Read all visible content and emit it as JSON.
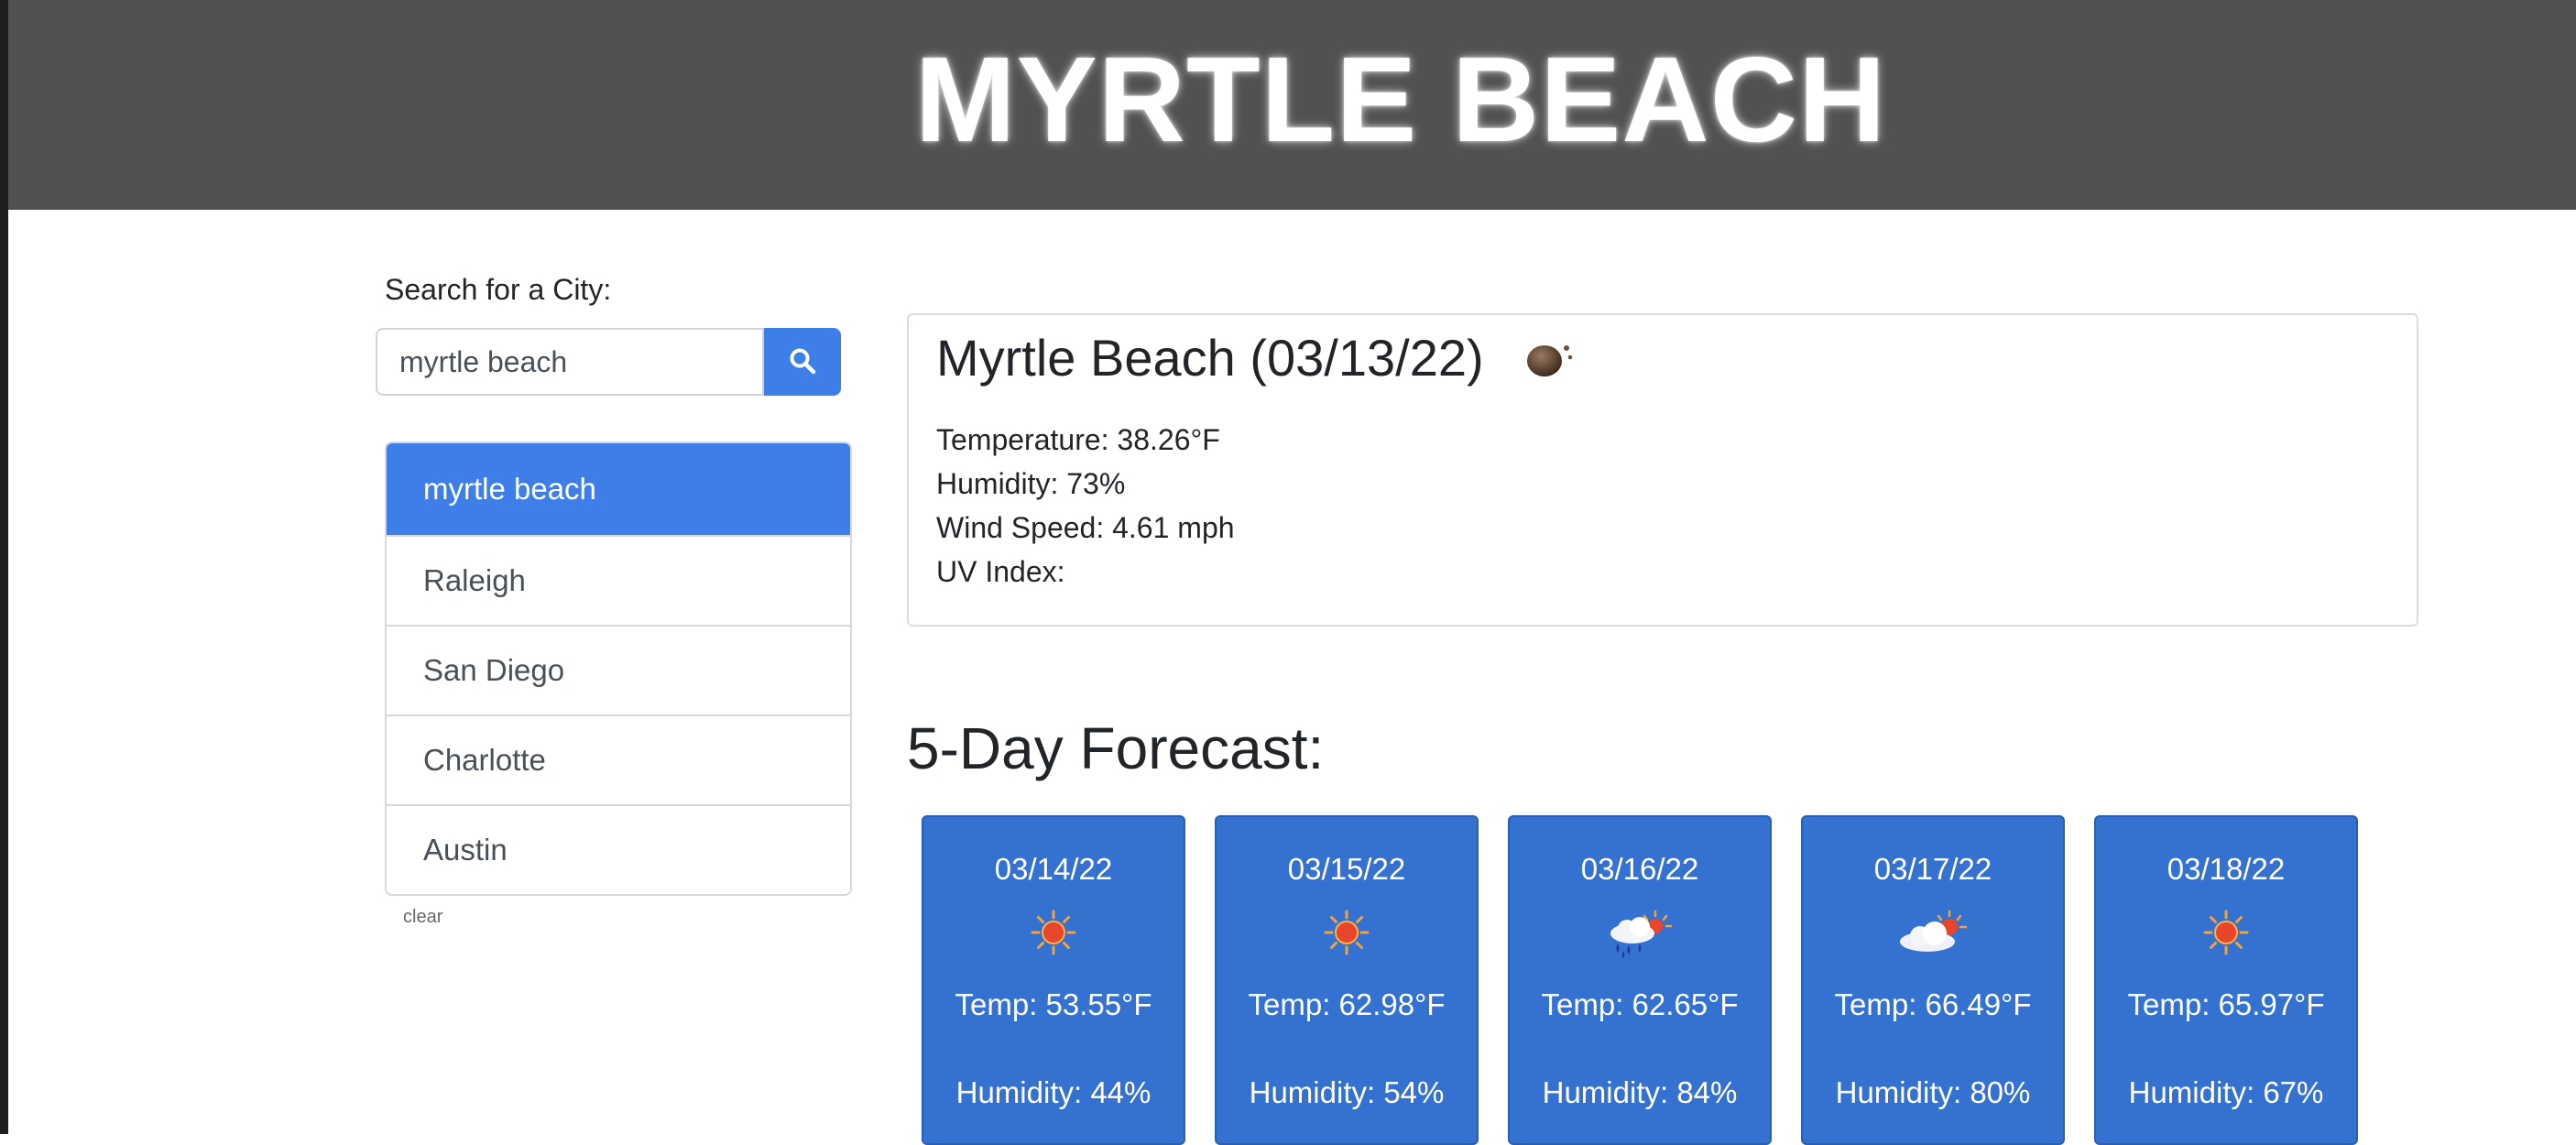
{
  "header": {
    "title": "MYRTLE BEACH"
  },
  "search": {
    "label": "Search for a City:",
    "value": "myrtle beach",
    "button_icon": "search-icon"
  },
  "history": {
    "items": [
      {
        "label": "myrtle beach",
        "active": true
      },
      {
        "label": "Raleigh",
        "active": false
      },
      {
        "label": "San Diego",
        "active": false
      },
      {
        "label": "Charlotte",
        "active": false
      },
      {
        "label": "Austin",
        "active": false
      }
    ],
    "clear_label": "clear"
  },
  "current": {
    "title": "Myrtle Beach (03/13/22)",
    "icon": "night-clear-moon-icon",
    "temperature": "Temperature: 38.26°F",
    "humidity": "Humidity: 73%",
    "wind": "Wind Speed: 4.61 mph",
    "uv": "UV Index:"
  },
  "forecast": {
    "heading": "5-Day Forecast:",
    "days": [
      {
        "date": "03/14/22",
        "icon": "sun-icon",
        "temp": "Temp: 53.55°F",
        "humidity": "Humidity: 44%"
      },
      {
        "date": "03/15/22",
        "icon": "sun-icon",
        "temp": "Temp: 62.98°F",
        "humidity": "Humidity: 54%"
      },
      {
        "date": "03/16/22",
        "icon": "rain-cloud-sun-icon",
        "temp": "Temp: 62.65°F",
        "humidity": "Humidity: 84%"
      },
      {
        "date": "03/17/22",
        "icon": "cloud-sun-icon",
        "temp": "Temp: 66.49°F",
        "humidity": "Humidity: 80%"
      },
      {
        "date": "03/18/22",
        "icon": "sun-icon",
        "temp": "Temp: 65.97°F",
        "humidity": "Humidity: 67%"
      }
    ]
  },
  "colors": {
    "header_bg": "#515151",
    "accent_blue": "#3e7ee8",
    "forecast_card_bg": "#3471d0"
  }
}
